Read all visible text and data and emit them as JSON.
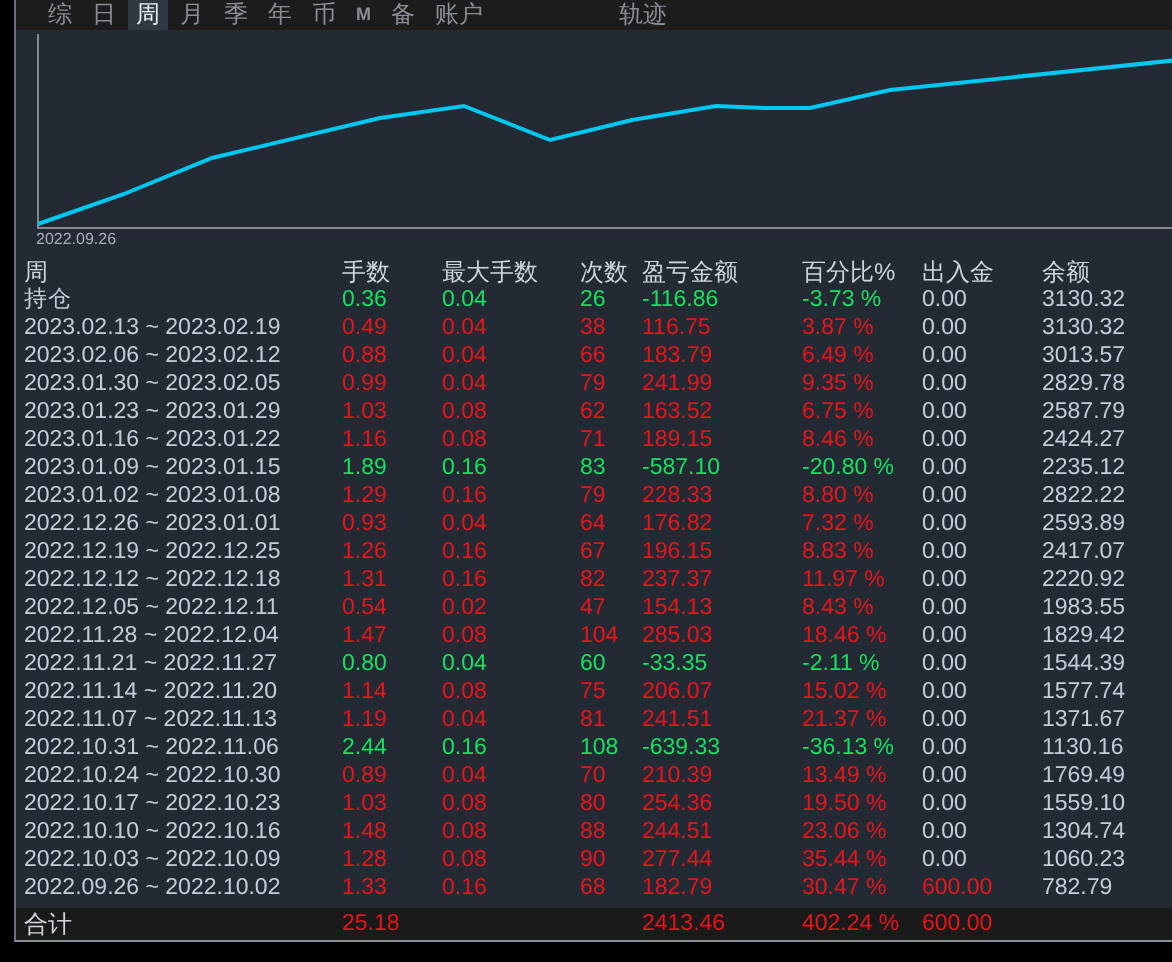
{
  "tabs": [
    {
      "label": "综",
      "selected": false
    },
    {
      "label": "日",
      "selected": false
    },
    {
      "label": "周",
      "selected": true
    },
    {
      "label": "月",
      "selected": false
    },
    {
      "label": "季",
      "selected": false
    },
    {
      "label": "年",
      "selected": false
    },
    {
      "label": "币",
      "selected": false
    },
    {
      "label": "M",
      "selected": false
    },
    {
      "label": "备",
      "selected": false
    },
    {
      "label": "账户",
      "selected": false
    }
  ],
  "track_label": "轨迹",
  "chart": {
    "start_label": "2022.09.26"
  },
  "table": {
    "columns": [
      "周",
      "手数",
      "最大手数",
      "次数",
      "盈亏金额",
      "百分比%",
      "出入金",
      "余额"
    ],
    "rows": [
      {
        "period": "持仓",
        "lots": "0.36",
        "max_lots": "0.04",
        "trades": "26",
        "profit": "-116.86",
        "percent": "-3.73 %",
        "deposit": "0.00",
        "balance": "3130.32",
        "negative": true,
        "deposit_marked": false
      },
      {
        "period": "2023.02.13 ~ 2023.02.19",
        "lots": "0.49",
        "max_lots": "0.04",
        "trades": "38",
        "profit": "116.75",
        "percent": "3.87 %",
        "deposit": "0.00",
        "balance": "3130.32",
        "negative": false,
        "deposit_marked": false
      },
      {
        "period": "2023.02.06 ~ 2023.02.12",
        "lots": "0.88",
        "max_lots": "0.04",
        "trades": "66",
        "profit": "183.79",
        "percent": "6.49 %",
        "deposit": "0.00",
        "balance": "3013.57",
        "negative": false,
        "deposit_marked": false
      },
      {
        "period": "2023.01.30 ~ 2023.02.05",
        "lots": "0.99",
        "max_lots": "0.04",
        "trades": "79",
        "profit": "241.99",
        "percent": "9.35 %",
        "deposit": "0.00",
        "balance": "2829.78",
        "negative": false,
        "deposit_marked": false
      },
      {
        "period": "2023.01.23 ~ 2023.01.29",
        "lots": "1.03",
        "max_lots": "0.08",
        "trades": "62",
        "profit": "163.52",
        "percent": "6.75 %",
        "deposit": "0.00",
        "balance": "2587.79",
        "negative": false,
        "deposit_marked": false
      },
      {
        "period": "2023.01.16 ~ 2023.01.22",
        "lots": "1.16",
        "max_lots": "0.08",
        "trades": "71",
        "profit": "189.15",
        "percent": "8.46 %",
        "deposit": "0.00",
        "balance": "2424.27",
        "negative": false,
        "deposit_marked": false
      },
      {
        "period": "2023.01.09 ~ 2023.01.15",
        "lots": "1.89",
        "max_lots": "0.16",
        "trades": "83",
        "profit": "-587.10",
        "percent": "-20.80 %",
        "deposit": "0.00",
        "balance": "2235.12",
        "negative": true,
        "deposit_marked": false
      },
      {
        "period": "2023.01.02 ~ 2023.01.08",
        "lots": "1.29",
        "max_lots": "0.16",
        "trades": "79",
        "profit": "228.33",
        "percent": "8.80 %",
        "deposit": "0.00",
        "balance": "2822.22",
        "negative": false,
        "deposit_marked": false
      },
      {
        "period": "2022.12.26 ~ 2023.01.01",
        "lots": "0.93",
        "max_lots": "0.04",
        "trades": "64",
        "profit": "176.82",
        "percent": "7.32 %",
        "deposit": "0.00",
        "balance": "2593.89",
        "negative": false,
        "deposit_marked": false
      },
      {
        "period": "2022.12.19 ~ 2022.12.25",
        "lots": "1.26",
        "max_lots": "0.16",
        "trades": "67",
        "profit": "196.15",
        "percent": "8.83 %",
        "deposit": "0.00",
        "balance": "2417.07",
        "negative": false,
        "deposit_marked": false
      },
      {
        "period": "2022.12.12 ~ 2022.12.18",
        "lots": "1.31",
        "max_lots": "0.16",
        "trades": "82",
        "profit": "237.37",
        "percent": "11.97 %",
        "deposit": "0.00",
        "balance": "2220.92",
        "negative": false,
        "deposit_marked": false
      },
      {
        "period": "2022.12.05 ~ 2022.12.11",
        "lots": "0.54",
        "max_lots": "0.02",
        "trades": "47",
        "profit": "154.13",
        "percent": "8.43 %",
        "deposit": "0.00",
        "balance": "1983.55",
        "negative": false,
        "deposit_marked": false
      },
      {
        "period": "2022.11.28 ~ 2022.12.04",
        "lots": "1.47",
        "max_lots": "0.08",
        "trades": "104",
        "profit": "285.03",
        "percent": "18.46 %",
        "deposit": "0.00",
        "balance": "1829.42",
        "negative": false,
        "deposit_marked": false
      },
      {
        "period": "2022.11.21 ~ 2022.11.27",
        "lots": "0.80",
        "max_lots": "0.04",
        "trades": "60",
        "profit": "-33.35",
        "percent": "-2.11 %",
        "deposit": "0.00",
        "balance": "1544.39",
        "negative": true,
        "deposit_marked": false
      },
      {
        "period": "2022.11.14 ~ 2022.11.20",
        "lots": "1.14",
        "max_lots": "0.08",
        "trades": "75",
        "profit": "206.07",
        "percent": "15.02 %",
        "deposit": "0.00",
        "balance": "1577.74",
        "negative": false,
        "deposit_marked": false
      },
      {
        "period": "2022.11.07 ~ 2022.11.13",
        "lots": "1.19",
        "max_lots": "0.04",
        "trades": "81",
        "profit": "241.51",
        "percent": "21.37 %",
        "deposit": "0.00",
        "balance": "1371.67",
        "negative": false,
        "deposit_marked": false
      },
      {
        "period": "2022.10.31 ~ 2022.11.06",
        "lots": "2.44",
        "max_lots": "0.16",
        "trades": "108",
        "profit": "-639.33",
        "percent": "-36.13 %",
        "deposit": "0.00",
        "balance": "1130.16",
        "negative": true,
        "deposit_marked": false
      },
      {
        "period": "2022.10.24 ~ 2022.10.30",
        "lots": "0.89",
        "max_lots": "0.04",
        "trades": "70",
        "profit": "210.39",
        "percent": "13.49 %",
        "deposit": "0.00",
        "balance": "1769.49",
        "negative": false,
        "deposit_marked": false
      },
      {
        "period": "2022.10.17 ~ 2022.10.23",
        "lots": "1.03",
        "max_lots": "0.08",
        "trades": "80",
        "profit": "254.36",
        "percent": "19.50 %",
        "deposit": "0.00",
        "balance": "1559.10",
        "negative": false,
        "deposit_marked": false
      },
      {
        "period": "2022.10.10 ~ 2022.10.16",
        "lots": "1.48",
        "max_lots": "0.08",
        "trades": "88",
        "profit": "244.51",
        "percent": "23.06 %",
        "deposit": "0.00",
        "balance": "1304.74",
        "negative": false,
        "deposit_marked": false
      },
      {
        "period": "2022.10.03 ~ 2022.10.09",
        "lots": "1.28",
        "max_lots": "0.08",
        "trades": "90",
        "profit": "277.44",
        "percent": "35.44 %",
        "deposit": "0.00",
        "balance": "1060.23",
        "negative": false,
        "deposit_marked": false
      },
      {
        "period": "2022.09.26 ~ 2022.10.02",
        "lots": "1.33",
        "max_lots": "0.16",
        "trades": "68",
        "profit": "182.79",
        "percent": "30.47 %",
        "deposit": "600.00",
        "balance": "782.79",
        "negative": false,
        "deposit_marked": true
      }
    ],
    "total": {
      "label": "合计",
      "lots": "25.18",
      "profit": "2413.46",
      "percent": "402.24 %",
      "deposit": "600.00"
    }
  }
}
